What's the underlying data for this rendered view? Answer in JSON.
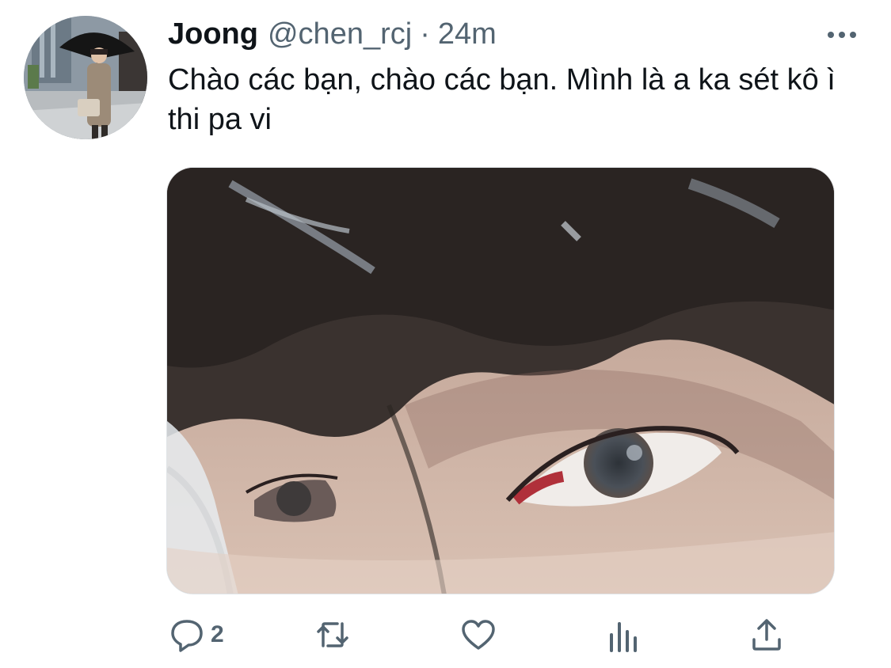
{
  "tweet": {
    "display_name": "Joong",
    "handle": "@chen_rcj",
    "separator": "·",
    "time": "24m",
    "text": "Chào các bạn, chào các bạn. Mình là a ka sét kô ì thi pa vi"
  },
  "actions": {
    "reply_count": "2"
  },
  "icons": {
    "reply": "reply-icon",
    "retweet": "retweet-icon",
    "like": "heart-icon",
    "views": "views-icon",
    "share": "share-icon",
    "more": "more-icon"
  },
  "colors": {
    "text": "#0f1419",
    "secondary": "#536471",
    "background": "#ffffff"
  }
}
